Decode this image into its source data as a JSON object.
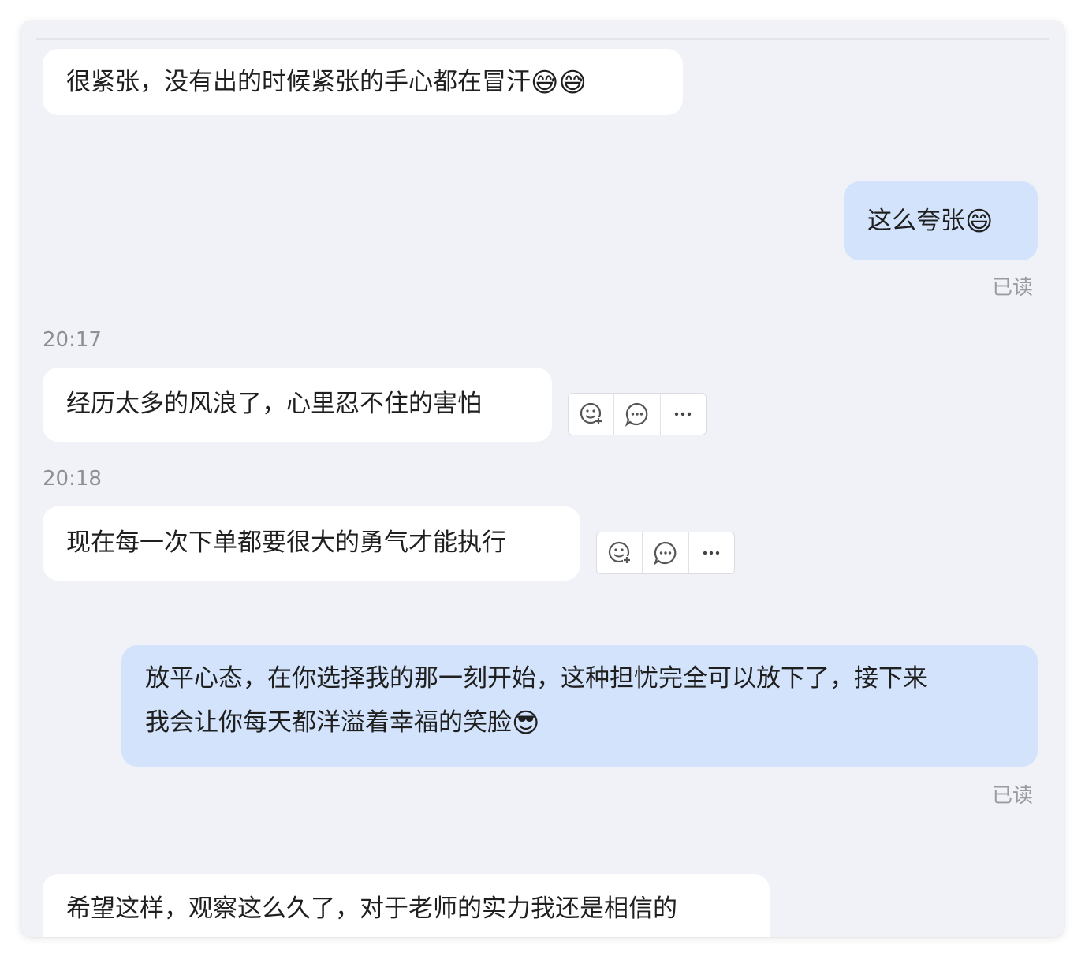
{
  "messages": [
    {
      "side": "in",
      "text": "很紧张，没有出的时候紧张的手心都在冒汗",
      "emoji": "😅😅"
    },
    {
      "side": "out",
      "text": "这么夸张",
      "emoji": "😄",
      "status": "已读"
    },
    {
      "time": "20:17"
    },
    {
      "side": "in",
      "text": "经历太多的风浪了，心里忍不住的害怕"
    },
    {
      "time": "20:18"
    },
    {
      "side": "in",
      "text": "现在每一次下单都要很大的勇气才能执行"
    },
    {
      "side": "out",
      "line1": "放平心态，在你选择我的那一刻开始，这种担忧完全可以放下了，接下来",
      "line2": "我会让你每天都洋溢着幸福的笑脸",
      "emoji": "😎",
      "status": "已读"
    },
    {
      "side": "in",
      "text": "希望这样，观察这么久了，对于老师的实力我还是相信的"
    }
  ],
  "message_actions": {
    "react_icon": "emoji-add-icon",
    "reply_icon": "comment-icon",
    "more_icon": "more-icon",
    "more_label": "···"
  }
}
